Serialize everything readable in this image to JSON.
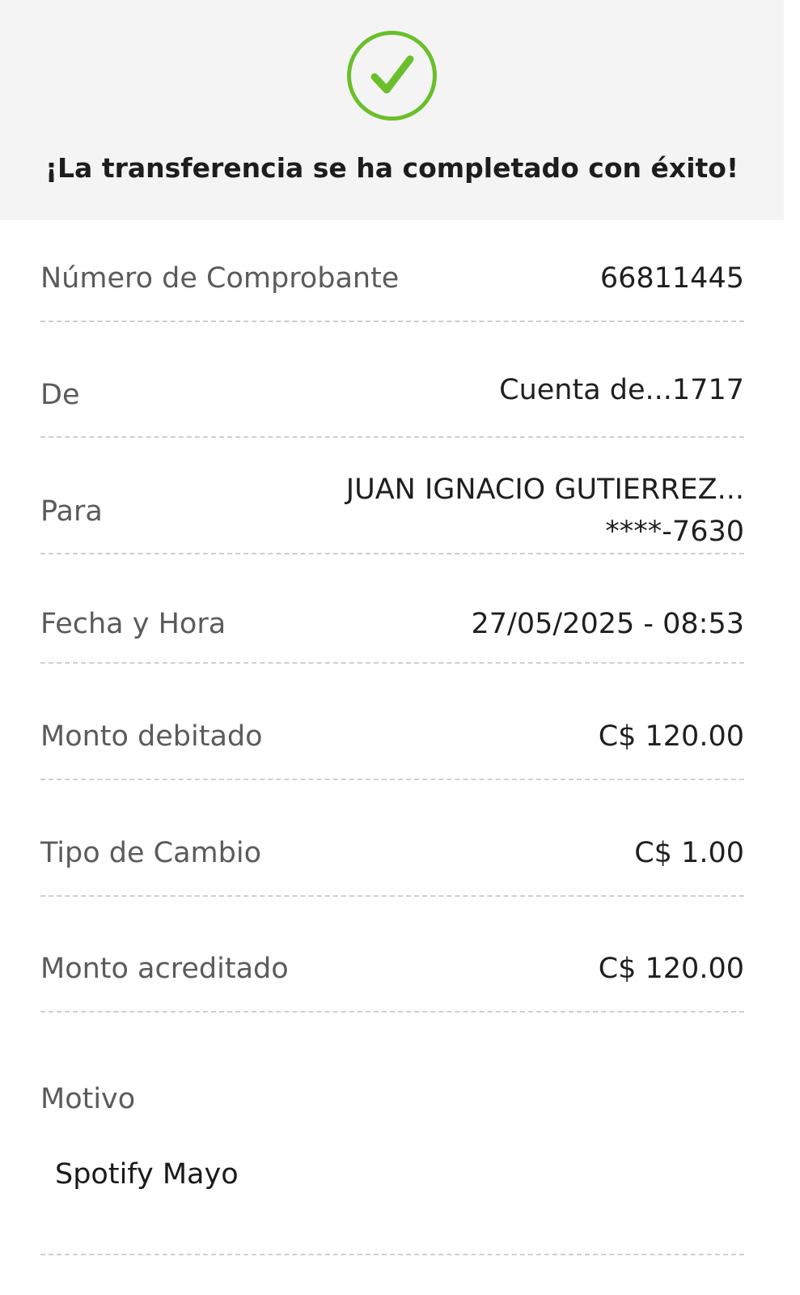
{
  "header": {
    "status_icon": "check-circle-icon",
    "title": "¡La transferencia se ha completado con éxito!",
    "accent_color": "#6abf2b"
  },
  "details": {
    "comprobante": {
      "label": "Número de Comprobante",
      "value": "66811445"
    },
    "de": {
      "label": "De",
      "value": "Cuenta de...1717"
    },
    "para": {
      "label": "Para",
      "value_line1": "JUAN IGNACIO GUTIERREZ...",
      "value_line2": "****-7630"
    },
    "fecha": {
      "label": "Fecha y Hora",
      "value": "27/05/2025 - 08:53"
    },
    "monto_debitado": {
      "label": "Monto debitado",
      "value": "C$ 120.00"
    },
    "tipo_cambio": {
      "label": "Tipo de Cambio",
      "value": "C$ 1.00"
    },
    "monto_acreditado": {
      "label": "Monto acreditado",
      "value": "C$ 120.00"
    },
    "motivo": {
      "label": "Motivo",
      "value": "Spotify Mayo"
    }
  }
}
